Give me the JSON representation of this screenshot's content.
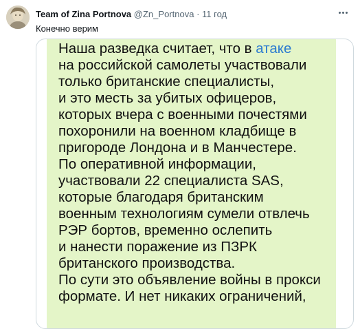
{
  "tweet": {
    "author_name": "Team of Zina Portnova",
    "handle": "@Zn_Portnova",
    "separator": "·",
    "time": "11 год",
    "text": "Конечно верим"
  },
  "image_message": {
    "lines": [
      {
        "text": "Наша разведка считает, что в ",
        "link": "атаке"
      },
      {
        "text": "на российской самолеты участвовали"
      },
      {
        "text": "только британские специалисты,"
      },
      {
        "text": "и это месть за убитых офицеров,"
      },
      {
        "text": "которых вчера с военными почестями"
      },
      {
        "text": "похоронили на военном кладбище в"
      },
      {
        "text": "пригороде Лондона и в Манчестере."
      },
      {
        "text": "По оперативной информации,"
      },
      {
        "text": "участвовали 22 специалиста SAS,"
      },
      {
        "text": "которые благодаря британским"
      },
      {
        "text": "военным технологиям сумели отвлечь"
      },
      {
        "text": "РЭР бортов, временно ослепить"
      },
      {
        "text": "и нанести поражение из ПЗРК"
      },
      {
        "text": "британского производства."
      },
      {
        "text": "По сути это объявление войны в прокси"
      },
      {
        "text": "формате. И нет никаких ограничений,"
      }
    ]
  },
  "colors": {
    "bubble": "#e4f5c8",
    "link": "#2b7bd0",
    "secondary_text": "#536471"
  },
  "icons": {
    "more": "more-horizontal-icon"
  }
}
